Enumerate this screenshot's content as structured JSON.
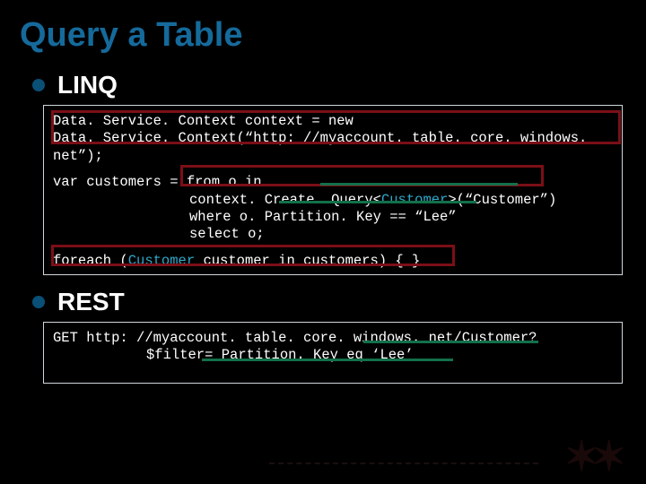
{
  "title": "Query a Table",
  "bullets": {
    "linq_label": "LINQ",
    "rest_label": "REST"
  },
  "linq_code": {
    "line1a": "Data. Service. Context context = new",
    "line1b": "Data. Service. Context(“http: //myaccount. table. core. windows. net”);",
    "line2a": "var customers = from o in",
    "line2b_prefix": "context. Create. Query<",
    "line2b_type": "Customer",
    "line2b_suffix": ">(“Customer”)",
    "line2c": "where o. Partition. Key == “Lee”",
    "line2d": "select o;",
    "line3_prefix": "foreach (",
    "line3_type": "Customer",
    "line3_suffix": " customer in customers) { }"
  },
  "rest_code": {
    "line1": "GET http: //myaccount. table. core. windows. net/Customer?",
    "line2": "$filter= Partition. Key eq ‘Lee’"
  }
}
